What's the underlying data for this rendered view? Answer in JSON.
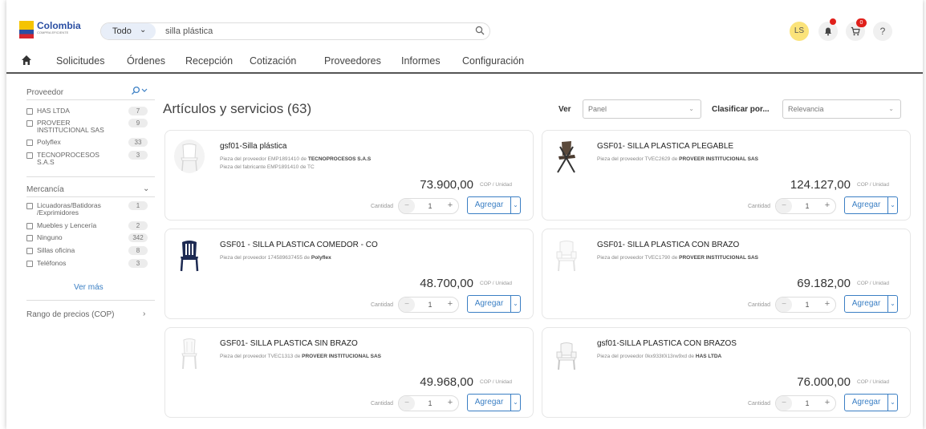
{
  "header": {
    "logo_title": "Colombia",
    "logo_subtitle": "COMPRA EFICIENTE",
    "search_scope": "Todo",
    "search_value": "silla plástica",
    "avatar_initials": "LS",
    "cart_count": "0",
    "help_label": "?"
  },
  "nav": [
    "Solicitudes",
    "Órdenes",
    "Recepción",
    "Cotización",
    "Proveedores",
    "Informes",
    "Configuración"
  ],
  "sidebar": {
    "proveedor_title": "Proveedor",
    "proveedores": [
      {
        "label": "HAS LTDA",
        "count": "7"
      },
      {
        "label": "PROVEER INSTITUCIONAL SAS",
        "count": "9"
      },
      {
        "label": "Polyflex",
        "count": "33"
      },
      {
        "label": "TECNOPROCESOS S.A.S",
        "count": "3"
      }
    ],
    "mercancia_title": "Mercancía",
    "mercancias": [
      {
        "label": "Licuadoras/Batidoras /Exprimidores",
        "count": "1"
      },
      {
        "label": "Muebles y Lencería",
        "count": "2"
      },
      {
        "label": "Ninguno",
        "count": "342"
      },
      {
        "label": "Sillas oficina",
        "count": "8"
      },
      {
        "label": "Teléfonos",
        "count": "3"
      }
    ],
    "ver_mas": "Ver más",
    "precio_title": "Rango de precios (COP)"
  },
  "main": {
    "title": "Artículos y servicios (63)",
    "ver_label": "Ver",
    "ver_value": "Panel",
    "clasificar_label": "Clasificar por...",
    "clasificar_value": "Relevancia",
    "quantity_label": "Cantidad",
    "add_label": "Agregar",
    "unit_label": "COP / Unidad",
    "products": [
      {
        "name": "gsf01-Silla plástica",
        "line1_prefix": "Pieza del proveedor EMP1891410 de",
        "line1_vendor": "TECNOPROCESOS S.A.S",
        "line2": "Pieza del fabricante EMP1891410 de TC",
        "price": "73.900,00",
        "qty": "1",
        "image": "white-chair-icon"
      },
      {
        "name": "GSF01- SILLA PLASTICA PLEGABLE",
        "line1_prefix": "Pieza del proveedor TVEC2629 de",
        "line1_vendor": "PROVEER INSTITUCIONAL SAS",
        "line2": "",
        "price": "124.127,00",
        "qty": "1",
        "image": "folding-chair-icon"
      },
      {
        "name": "GSF01 - SILLA PLASTICA COMEDOR - CO",
        "line1_prefix": "Pieza del proveedor 174589637455 de",
        "line1_vendor": "Polyflex",
        "line2": "",
        "price": "48.700,00",
        "qty": "1",
        "image": "navy-chair-icon"
      },
      {
        "name": "GSF01- SILLA PLASTICA CON BRAZO",
        "line1_prefix": "Pieza del proveedor TVEC1790 de",
        "line1_vendor": "PROVEER INSTITUCIONAL SAS",
        "line2": "",
        "price": "69.182,00",
        "qty": "1",
        "image": "armchair-icon"
      },
      {
        "name": "GSF01- SILLA PLASTICA SIN BRAZO",
        "line1_prefix": "Pieza del proveedor TVEC1313 de",
        "line1_vendor": "PROVEER INSTITUCIONAL SAS",
        "line2": "",
        "price": "49.968,00",
        "qty": "1",
        "image": "white-chair-icon"
      },
      {
        "name": "gsf01-SILLA PLASTICA CON BRAZOS",
        "line1_prefix": "Pieza del proveedor 0kx933t0i13rw9xd de",
        "line1_vendor": "HAS LTDA",
        "line2": "",
        "price": "76.000,00",
        "qty": "1",
        "image": "armchair-icon"
      }
    ]
  },
  "colors": {
    "accent": "#3b7fc4",
    "badge": "#e0201b",
    "avatar": "#fbe37a"
  }
}
